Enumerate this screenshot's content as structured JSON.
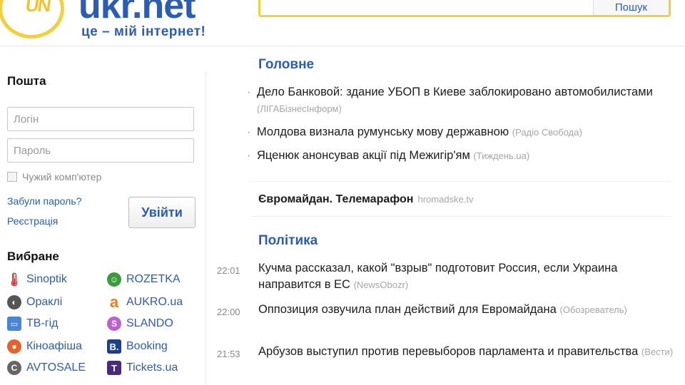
{
  "header": {
    "logo_mark": "UN",
    "logo_text": "ukr.net",
    "slogan": "це – мій інтернет!",
    "search_button": "Пошук",
    "brand_blue": "#2a5db3",
    "brand_yellow": "#f4cf3a"
  },
  "mail": {
    "title": "Пошта",
    "login_placeholder": "Логін",
    "password_placeholder": "Пароль",
    "remember_label": "Чужий комп'ютер",
    "forgot_link": "Забули пароль?",
    "register_link": "Реєстрація",
    "login_button": "Увійти"
  },
  "favorites": {
    "title": "Вибране",
    "items": [
      {
        "label": "Sinoptik",
        "icon": "thermometer-icon"
      },
      {
        "label": "ROZETKA",
        "icon": "rozetka-icon"
      },
      {
        "label": "Ораклі",
        "icon": "oracle-icon"
      },
      {
        "label": "AUKRO.ua",
        "icon": "aukro-icon"
      },
      {
        "label": "ТВ-гід",
        "icon": "tv-icon"
      },
      {
        "label": "SLANDO",
        "icon": "slando-icon"
      },
      {
        "label": "Кіноафіша",
        "icon": "film-icon"
      },
      {
        "label": "Booking",
        "icon": "booking-icon"
      },
      {
        "label": "AVTOSALE",
        "icon": "car-icon"
      },
      {
        "label": "Tickets.ua",
        "icon": "ticket-icon"
      }
    ]
  },
  "main": {
    "headlines_title": "Головне",
    "headlines": [
      {
        "text": "Дело Банковой: здание УБОП в Киеве заблокировано автомобилистами",
        "source": "(ЛІГАБізнесІнформ)"
      },
      {
        "text": "Молдова визнала румунську мову державною",
        "source": "(Радіо Свобода)"
      },
      {
        "text": "Яценюк анонсував акції під Межигір'ям",
        "source": "(Тиждень.ua)"
      }
    ],
    "promo": {
      "text": "Євромайдан. Телемарафон",
      "source": "hromadske.tv"
    },
    "politics_title": "Політика",
    "politics": [
      {
        "time": "22:01",
        "text": "Кучма рассказал, какой \"взрыв\" подготовит Россия, если Украина направится в ЕС",
        "source": "(NewsObozr)"
      },
      {
        "time": "22:00",
        "text": "Оппозиция озвучила план действий для Евромайдана",
        "source": "(Обозреватель)"
      },
      {
        "time": "21:53",
        "text": "Арбузов выступил против перевыборов парламента и правительства",
        "source": "(Вести)"
      }
    ]
  }
}
